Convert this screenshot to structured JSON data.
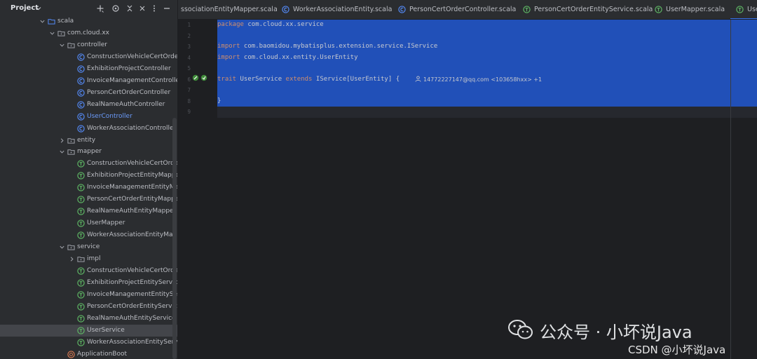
{
  "project_panel": {
    "title": "Project",
    "header_icons": [
      "add-icon",
      "target-icon",
      "collapse-icon",
      "close-icon",
      "more-icon",
      "minimize-icon"
    ],
    "tree": [
      {
        "label": "scala",
        "depth": 0,
        "chevron": "down",
        "icon": "source-folder-icon"
      },
      {
        "label": "com.cloud.xx",
        "depth": 1,
        "chevron": "down",
        "icon": "package-icon"
      },
      {
        "label": "controller",
        "depth": 2,
        "chevron": "down",
        "icon": "package-icon"
      },
      {
        "label": "ConstructionVehicleCertOrderCo",
        "depth": 3,
        "icon": "scala-class-icon"
      },
      {
        "label": "ExhibitionProjectController",
        "depth": 3,
        "icon": "scala-class-icon"
      },
      {
        "label": "InvoiceManagementController",
        "depth": 3,
        "icon": "scala-class-icon"
      },
      {
        "label": "PersonCertOrderController",
        "depth": 3,
        "icon": "scala-class-icon"
      },
      {
        "label": "RealNameAuthController",
        "depth": 3,
        "icon": "scala-class-icon"
      },
      {
        "label": "UserController",
        "depth": 3,
        "icon": "scala-class-icon",
        "active": true
      },
      {
        "label": "WorkerAssociationController",
        "depth": 3,
        "icon": "scala-class-icon"
      },
      {
        "label": "entity",
        "depth": 2,
        "chevron": "right",
        "icon": "package-icon"
      },
      {
        "label": "mapper",
        "depth": 2,
        "chevron": "down",
        "icon": "package-icon"
      },
      {
        "label": "ConstructionVehicleCertOrderEn",
        "depth": 3,
        "icon": "scala-trait-icon"
      },
      {
        "label": "ExhibitionProjectEntityMapper",
        "depth": 3,
        "icon": "scala-trait-icon"
      },
      {
        "label": "InvoiceManagementEntityMappe",
        "depth": 3,
        "icon": "scala-trait-icon"
      },
      {
        "label": "PersonCertOrderEntityMapper",
        "depth": 3,
        "icon": "scala-trait-icon"
      },
      {
        "label": "RealNameAuthEntityMapper",
        "depth": 3,
        "icon": "scala-trait-icon"
      },
      {
        "label": "UserMapper",
        "depth": 3,
        "icon": "scala-trait-icon"
      },
      {
        "label": "WorkerAssociationEntityMappe",
        "depth": 3,
        "icon": "scala-trait-icon"
      },
      {
        "label": "service",
        "depth": 2,
        "chevron": "down",
        "icon": "package-icon"
      },
      {
        "label": "impl",
        "depth": 3,
        "chevron": "right",
        "icon": "package-icon"
      },
      {
        "label": "ConstructionVehicleCertOrderEn",
        "depth": 3,
        "icon": "scala-trait-icon"
      },
      {
        "label": "ExhibitionProjectEntityService",
        "depth": 3,
        "icon": "scala-trait-icon"
      },
      {
        "label": "InvoiceManagementEntityServic",
        "depth": 3,
        "icon": "scala-trait-icon"
      },
      {
        "label": "PersonCertOrderEntityService",
        "depth": 3,
        "icon": "scala-trait-icon"
      },
      {
        "label": "RealNameAuthEntityService",
        "depth": 3,
        "icon": "scala-trait-icon"
      },
      {
        "label": "UserService",
        "depth": 3,
        "icon": "scala-trait-icon",
        "selected": true
      },
      {
        "label": "WorkerAssociationEntityService",
        "depth": 3,
        "icon": "scala-trait-icon"
      },
      {
        "label": "ApplicationBoot",
        "depth": 2,
        "icon": "scala-object-icon"
      }
    ]
  },
  "tabs": [
    {
      "label": "ssociationEntityMapper.scala",
      "icon": "",
      "active": false
    },
    {
      "label": "WorkerAssociationEntity.scala",
      "icon": "scala-class-icon",
      "active": false
    },
    {
      "label": "PersonCertOrderController.scala",
      "icon": "scala-class-icon",
      "active": false
    },
    {
      "label": "PersonCertOrderEntityService.scala",
      "icon": "scala-trait-icon",
      "active": false
    },
    {
      "label": "UserMapper.scala",
      "icon": "scala-trait-icon",
      "active": false
    },
    {
      "label": "Use",
      "icon": "scala-trait-icon",
      "active": true
    }
  ],
  "editor": {
    "line_numbers": [
      "1",
      "2",
      "3",
      "4",
      "5",
      "6",
      "7",
      "8",
      "9"
    ],
    "lines": [
      [
        {
          "t": "package",
          "k": true
        },
        {
          "t": " com.cloud.xx.service"
        }
      ],
      [],
      [
        {
          "t": "import",
          "k": true
        },
        {
          "t": " com.baomidou.mybatisplus.extension.service.IService"
        }
      ],
      [
        {
          "t": "import",
          "k": true
        },
        {
          "t": " com.cloud.xx.entity.UserEntity"
        }
      ],
      [],
      [
        {
          "t": "trait",
          "k": true
        },
        {
          "t": " UserService "
        },
        {
          "t": "extends",
          "k": true
        },
        {
          "t": " IService[UserEntity] {"
        }
      ],
      [],
      [
        {
          "t": "}"
        }
      ],
      []
    ],
    "author_hint": "14772227147@qq.com <103658hxx> +1",
    "colors": {
      "selection": "#2150b8",
      "keyword": "#cf8e6d",
      "accent": "#3574f0",
      "active_file": "#6b9bfa"
    }
  },
  "watermark": {
    "line1": "公众号 · 小坏说Java",
    "line2": "CSDN @小坏说Java"
  }
}
